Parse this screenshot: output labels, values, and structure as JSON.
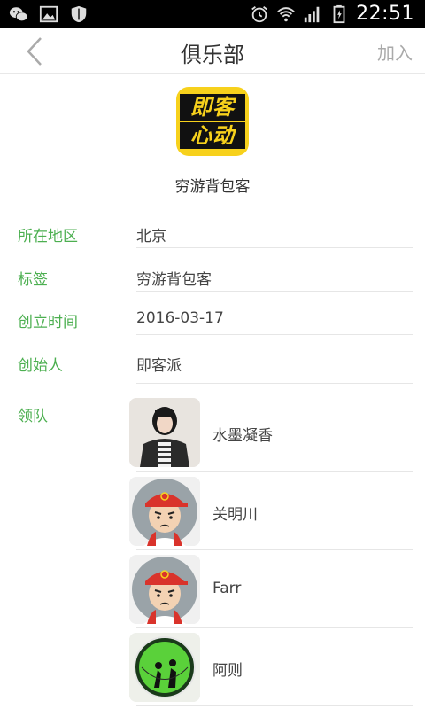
{
  "status_bar": {
    "time": "22:51"
  },
  "app_bar": {
    "title": "俱乐部",
    "join_label": "加入"
  },
  "club": {
    "logo_text": [
      "即客",
      "心动"
    ],
    "name": "穷游背包客"
  },
  "info": [
    {
      "label": "所在地区",
      "value": "北京"
    },
    {
      "label": "标签",
      "value": "穷游背包客"
    },
    {
      "label": "创立时间",
      "value": "2016-03-17"
    },
    {
      "label": "创始人",
      "value": "即客派"
    }
  ],
  "leaders_label": "领队",
  "leaders": [
    {
      "name": "水墨凝香",
      "avatar": "girl-photo-avatar"
    },
    {
      "name": "关明川",
      "avatar": "cartoon-cap-avatar"
    },
    {
      "name": "Farr",
      "avatar": "cartoon-cap-avatar"
    },
    {
      "name": "阿则",
      "avatar": "hiking-badge-avatar"
    }
  ],
  "colors": {
    "accent_green": "#4caf50",
    "logo_yellow": "#f7d11c"
  }
}
